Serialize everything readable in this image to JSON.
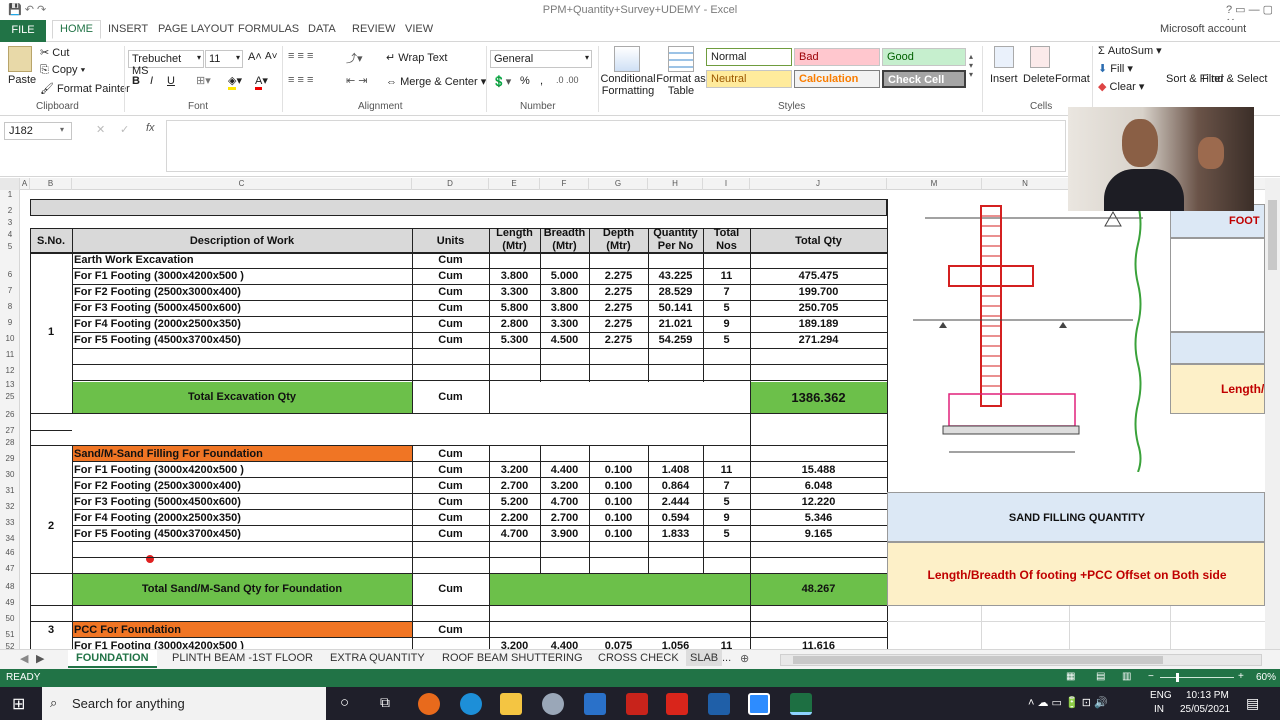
{
  "window": {
    "title": "PPM+Quantity+Survey+UDEMY - Excel",
    "account": "Microsoft account"
  },
  "ribbon_tabs": [
    "FILE",
    "HOME",
    "INSERT",
    "PAGE LAYOUT",
    "FORMULAS",
    "DATA",
    "REVIEW",
    "VIEW"
  ],
  "clipboard": {
    "paste": "Paste",
    "cut": "Cut",
    "copy": "Copy",
    "format_painter": "Format Painter",
    "label": "Clipboard"
  },
  "font": {
    "name": "Trebuchet MS",
    "size": "11",
    "bold": "B",
    "italic": "I",
    "underline": "U",
    "label": "Font"
  },
  "alignment": {
    "wrap": "Wrap Text",
    "merge": "Merge & Center",
    "label": "Alignment"
  },
  "number": {
    "format": "General",
    "percent": "%",
    "comma": ",",
    "label": "Number"
  },
  "styles": {
    "conditional": "Conditional Formatting",
    "format_table": "Format as Table",
    "normal": "Normal",
    "bad": "Bad",
    "good": "Good",
    "neutral": "Neutral",
    "calculation": "Calculation",
    "check": "Check Cell",
    "label": "Styles"
  },
  "cells_group": {
    "insert": "Insert",
    "delete": "Delete",
    "format": "Format",
    "label": "Cells"
  },
  "editing": {
    "autosum": "AutoSum",
    "fill": "Fill",
    "clear": "Clear",
    "sort": "Sort & Filter",
    "find": "Find & Select",
    "label": "Editing"
  },
  "formula_bar": {
    "name_box": "J182",
    "fx": "fx",
    "value": ""
  },
  "columns": [
    "A",
    "B",
    "C",
    "D",
    "E",
    "F",
    "G",
    "H",
    "I",
    "J",
    "",
    "M",
    "N"
  ],
  "rows": [
    "1",
    "2",
    "3",
    "4",
    "5",
    "6",
    "7",
    "8",
    "9",
    "10",
    "11",
    "12",
    "13",
    "25",
    "26",
    "27",
    "28",
    "29",
    "30",
    "31",
    "32",
    "33",
    "34",
    "46",
    "47",
    "48",
    "49",
    "50",
    "51",
    "52"
  ],
  "headers": {
    "sno": "S.No.",
    "desc": "Description of Work",
    "units": "Units",
    "length": "Length (Mtr)",
    "breadth": "Breadth (Mtr)",
    "depth": "Depth (Mtr)",
    "qty_per": "Quantity Per No",
    "total_nos": "Total Nos",
    "total_qty": "Total Qty"
  },
  "sections": [
    {
      "sno": "1",
      "title": "Earth Work Excavation",
      "unit": "Cum",
      "rows": [
        {
          "desc": "For F1 Footing (3000x4200x500 )",
          "unit": "Cum",
          "l": "3.800",
          "b": "5.000",
          "d": "2.275",
          "q": "43.225",
          "n": "11",
          "t": "475.475"
        },
        {
          "desc": "For F2 Footing (2500x3000x400)",
          "unit": "Cum",
          "l": "3.300",
          "b": "3.800",
          "d": "2.275",
          "q": "28.529",
          "n": "7",
          "t": "199.700"
        },
        {
          "desc": "For F3 Footing (5000x4500x600)",
          "unit": "Cum",
          "l": "5.800",
          "b": "3.800",
          "d": "2.275",
          "q": "50.141",
          "n": "5",
          "t": "250.705"
        },
        {
          "desc": "For F4 Footing (2000x2500x350)",
          "unit": "Cum",
          "l": "2.800",
          "b": "3.300",
          "d": "2.275",
          "q": "21.021",
          "n": "9",
          "t": "189.189"
        },
        {
          "desc": "For F5 Footing (4500x3700x450)",
          "unit": "Cum",
          "l": "5.300",
          "b": "4.500",
          "d": "2.275",
          "q": "54.259",
          "n": "5",
          "t": "271.294"
        }
      ],
      "total_label": "Total Excavation Qty",
      "total_unit": "Cum",
      "total": "1386.362"
    },
    {
      "sno": "2",
      "title": "Sand/M-Sand Filling For Foundation",
      "unit": "Cum",
      "rows": [
        {
          "desc": "For F1 Footing (3000x4200x500 )",
          "unit": "Cum",
          "l": "3.200",
          "b": "4.400",
          "d": "0.100",
          "q": "1.408",
          "n": "11",
          "t": "15.488"
        },
        {
          "desc": "For F2 Footing (2500x3000x400)",
          "unit": "Cum",
          "l": "2.700",
          "b": "3.200",
          "d": "0.100",
          "q": "0.864",
          "n": "7",
          "t": "6.048"
        },
        {
          "desc": "For F3 Footing (5000x4500x600)",
          "unit": "Cum",
          "l": "5.200",
          "b": "4.700",
          "d": "0.100",
          "q": "2.444",
          "n": "5",
          "t": "12.220"
        },
        {
          "desc": "For F4 Footing (2000x2500x350)",
          "unit": "Cum",
          "l": "2.200",
          "b": "2.700",
          "d": "0.100",
          "q": "0.594",
          "n": "9",
          "t": "5.346"
        },
        {
          "desc": "For F5 Footing (4500x3700x450)",
          "unit": "Cum",
          "l": "4.700",
          "b": "3.900",
          "d": "0.100",
          "q": "1.833",
          "n": "5",
          "t": "9.165"
        }
      ],
      "total_label": "Total Sand/M-Sand Qty for Foundation",
      "total_unit": "Cum",
      "total": "48.267"
    },
    {
      "sno": "3",
      "title": "PCC For Foundation",
      "unit": "Cum",
      "rows": [
        {
          "desc": "For F1 Footing (3000x4200x500 )",
          "unit": "Cum",
          "l": "3.200",
          "b": "4.400",
          "d": "0.075",
          "q": "1.056",
          "n": "11",
          "t": "11.616"
        }
      ]
    }
  ],
  "side_panel": {
    "foot_label": "FOOT",
    "length_label": "Length/",
    "sand_title": "SAND FILLING  QUANTITY",
    "sand_note": "Length/Breadth Of footing +PCC Offset on Both side"
  },
  "sheet_tabs": [
    "FOUNDATION",
    "PLINTH BEAM -1ST FLOOR",
    "EXTRA QUANTITY",
    "ROOF BEAM SHUTTERING",
    "CROSS CHECK",
    "SLAB",
    "..."
  ],
  "status": {
    "ready": "READY",
    "zoom": "60%"
  },
  "taskbar": {
    "search": "Search for anything",
    "lang": "ENG",
    "region": "IN",
    "time": "10:13 PM",
    "date": "25/05/2021"
  },
  "colors": {
    "excel_green": "#217346",
    "total_green": "#6cc04a",
    "section_orange": "#f07524",
    "panel_blue": "#dce8f5",
    "panel_cream": "#fdf0c8",
    "red_text": "#c00000"
  }
}
